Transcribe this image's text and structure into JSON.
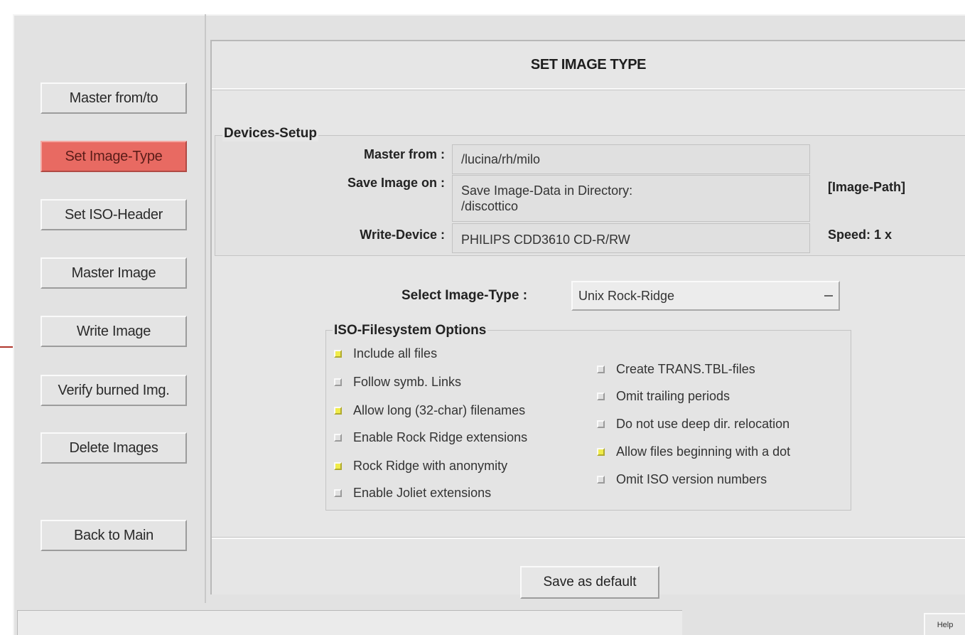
{
  "sidebar": {
    "buttons": [
      {
        "label": "Master from/to"
      },
      {
        "label": "Set Image-Type"
      },
      {
        "label": "Set ISO-Header"
      },
      {
        "label": "Master Image"
      },
      {
        "label": "Write Image"
      },
      {
        "label": "Verify burned Img."
      },
      {
        "label": "Delete Images"
      },
      {
        "label": "Back to Main"
      }
    ]
  },
  "header": {
    "title": "SET IMAGE TYPE"
  },
  "devices": {
    "group_label": "Devices-Setup",
    "master_from_label": "Master from :",
    "master_from_value": "/lucina/rh/milo",
    "save_image_label": "Save Image on :",
    "save_image_line1": "Save Image-Data in Directory:",
    "save_image_line2": "/discottico",
    "image_path_label": "[Image-Path]",
    "write_device_label": "Write-Device :",
    "write_device_value": "PHILIPS  CDD3610 CD-R/RW",
    "speed_label": "Speed: 1 x"
  },
  "image_type": {
    "label": "Select Image-Type :",
    "selected": "Unix Rock-Ridge"
  },
  "iso_options": {
    "group_label": "ISO-Filesystem Options",
    "left": [
      {
        "label": "Include all files",
        "checked": true
      },
      {
        "label": "Follow symb. Links",
        "checked": false
      },
      {
        "label": "Allow long (32-char) filenames",
        "checked": true
      },
      {
        "label": "Enable Rock Ridge extensions",
        "checked": false
      },
      {
        "label": "Rock Ridge with anonymity",
        "checked": true
      },
      {
        "label": "Enable Joliet extensions",
        "checked": false
      }
    ],
    "right": [
      {
        "label": "Create TRANS.TBL-files",
        "checked": false
      },
      {
        "label": "Omit trailing periods",
        "checked": false
      },
      {
        "label": "Do not use deep dir. relocation",
        "checked": false
      },
      {
        "label": "Allow files beginning with a dot",
        "checked": true
      },
      {
        "label": "Omit ISO version numbers",
        "checked": false
      }
    ]
  },
  "footer": {
    "save_default_label": "Save as default",
    "help_label": "Help"
  },
  "colors": {
    "active_button": "#e86a62",
    "checkbox_on": "#f0ec4a",
    "panel_background": "#e2e2e2"
  }
}
